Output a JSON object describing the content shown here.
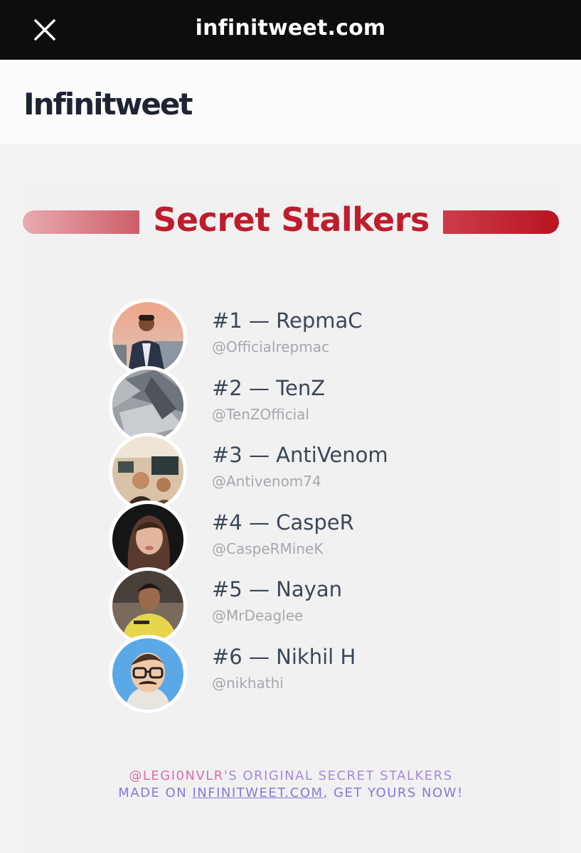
{
  "browser": {
    "url": "infinitweet.com",
    "close_icon": "close-icon"
  },
  "site": {
    "brand": "Infinitweet"
  },
  "card": {
    "title": "Secret Stalkers",
    "title_color": "#be1e2c",
    "items": [
      {
        "name": "#1 — RepmaC",
        "handle": "@Officialrepmac"
      },
      {
        "name": "#2 — TenZ",
        "handle": "@TenZOfficial"
      },
      {
        "name": "#3 — AntiVenom",
        "handle": "@Antivenom74"
      },
      {
        "name": "#4 — CaspeR",
        "handle": "@CaspeRMineK"
      },
      {
        "name": "#5 — Nayan",
        "handle": "@MrDeaglee"
      },
      {
        "name": "#6 — Nikhil H",
        "handle": "@nikhathi"
      }
    ]
  },
  "footer": {
    "author_handle": "@LEGI0NVLR",
    "line1_rest": "'S ORIGINAL SECRET STALKERS",
    "line2_prefix": "MADE ON ",
    "link_text": "INFINITWEET.COM",
    "line2_suffix": ", GET YOURS NOW!"
  }
}
